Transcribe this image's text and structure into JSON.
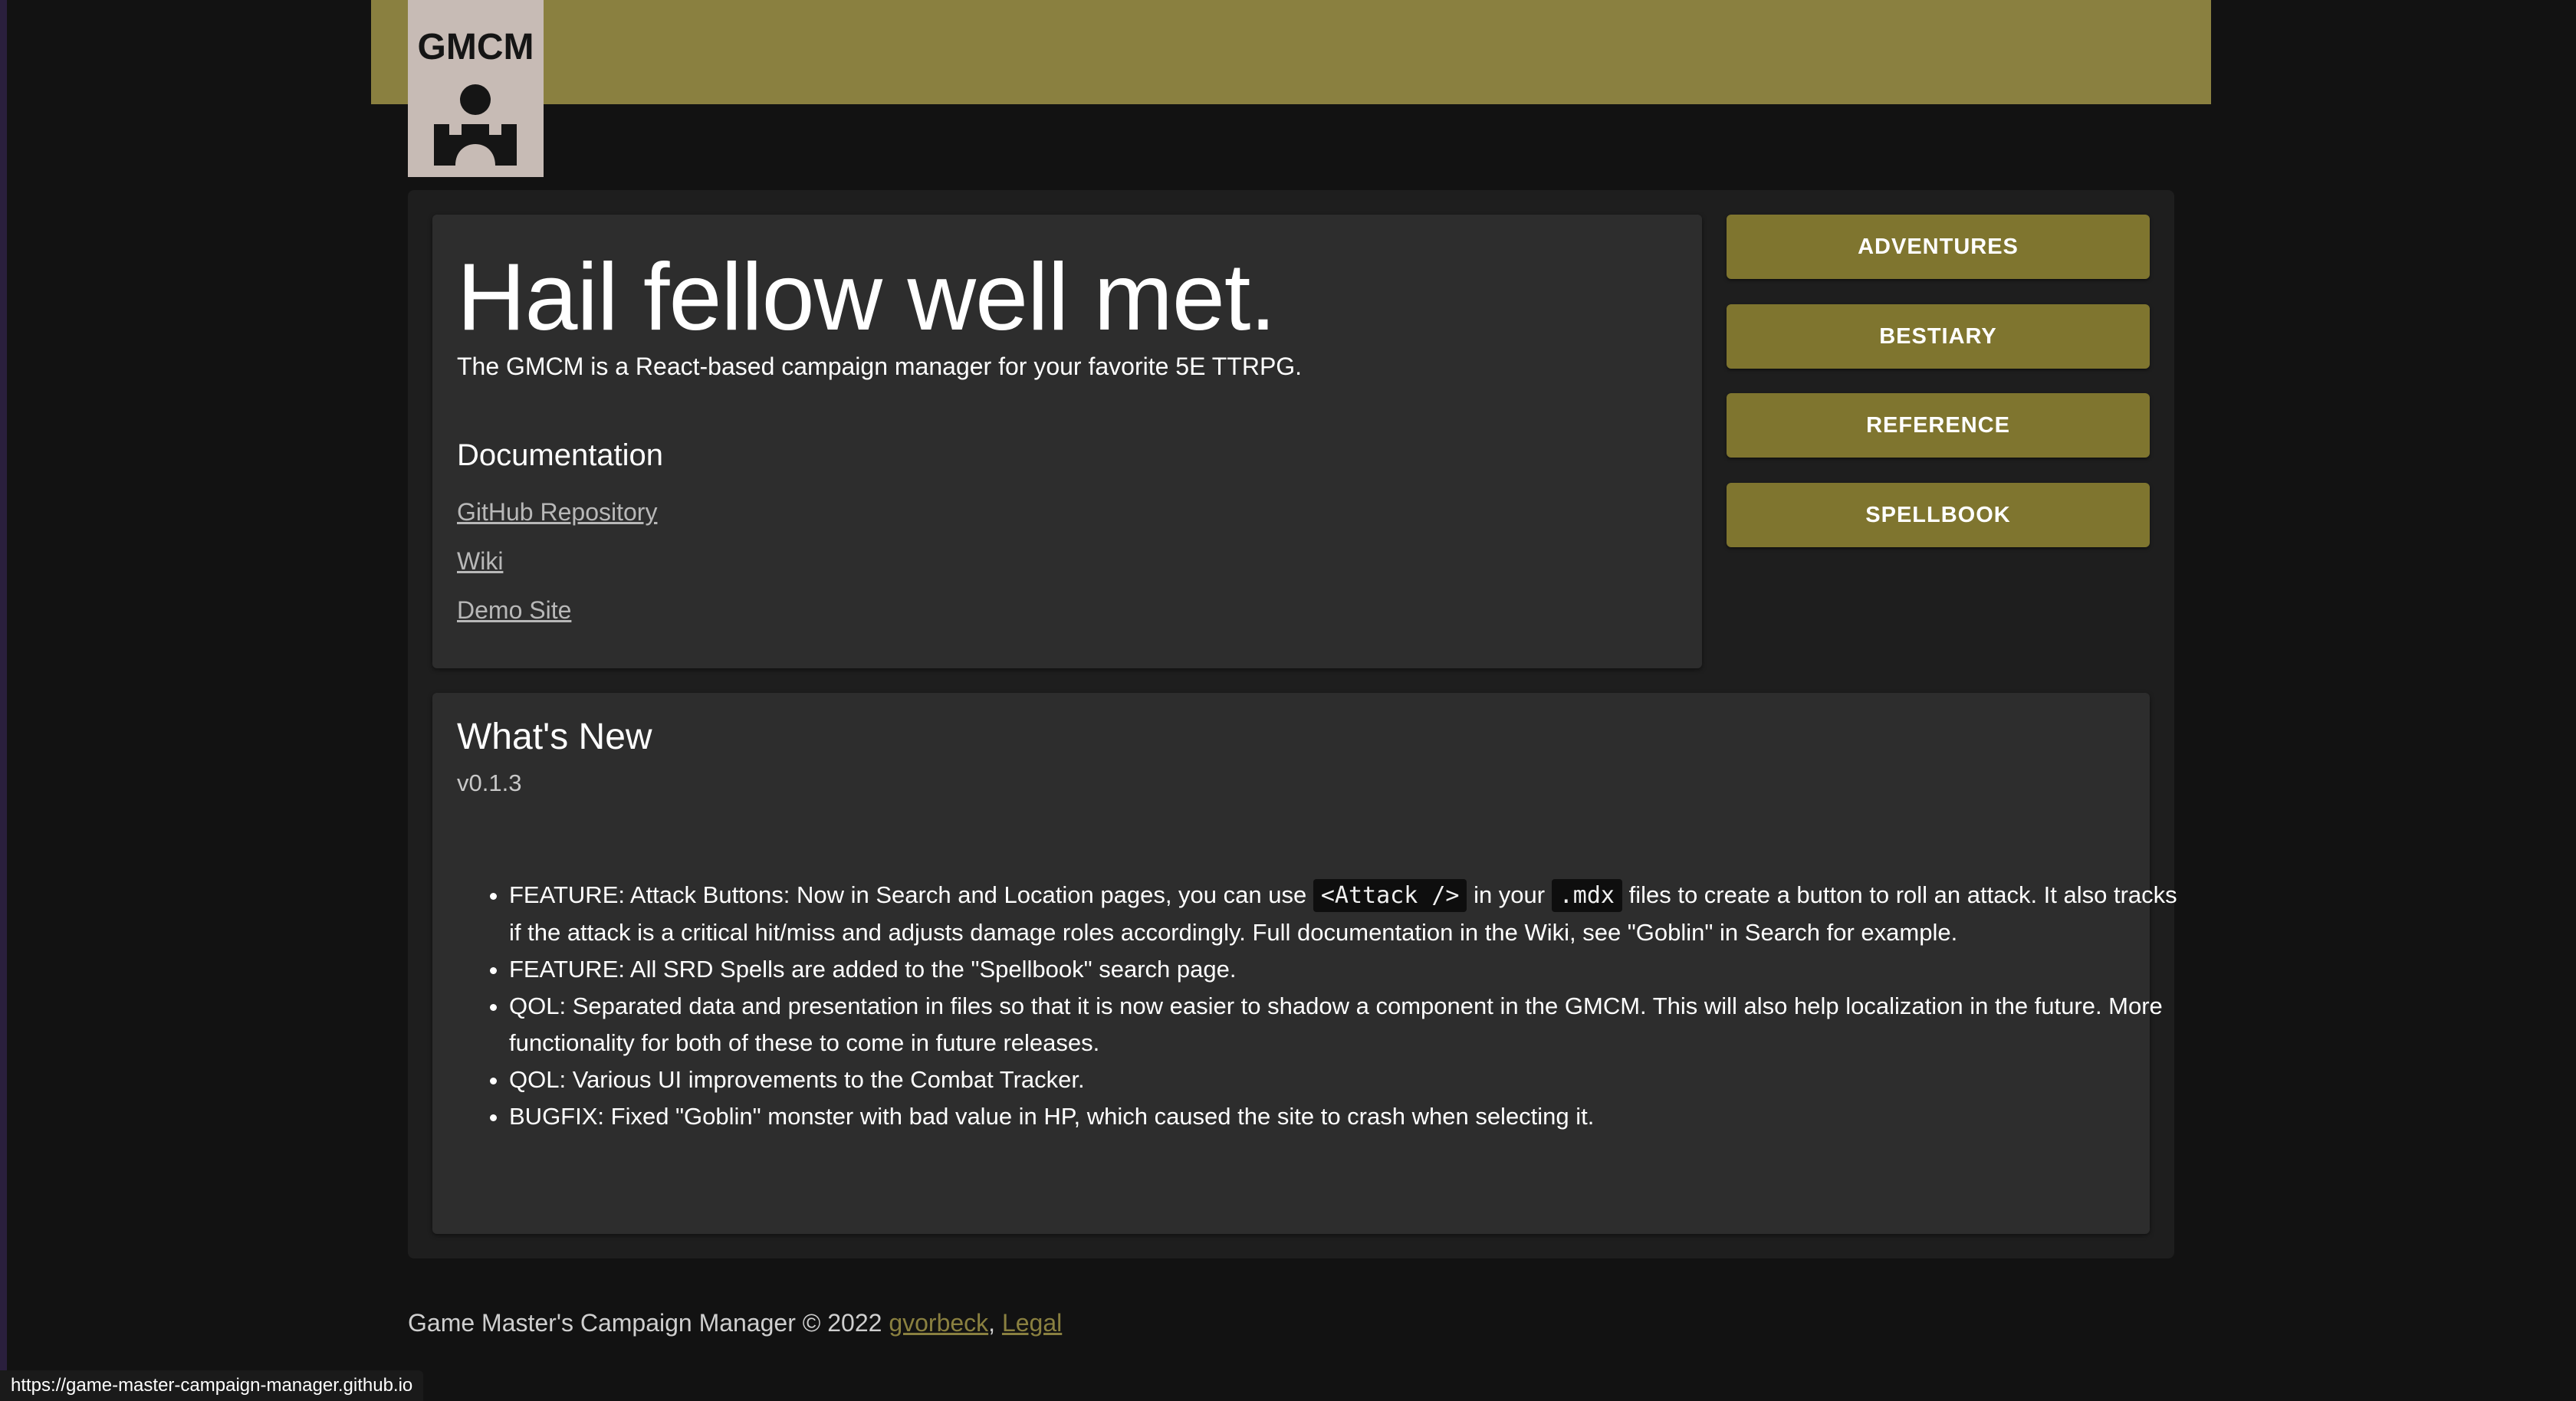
{
  "header": {
    "logo_text": "GMCM",
    "accent_color": "#8a8040",
    "logo_icon": "castle-person-icon"
  },
  "intro": {
    "title": "Hail fellow well met.",
    "description": "The GMCM is a React-based campaign manager for your favorite 5E TTRPG.",
    "documentation_heading": "Documentation",
    "links": [
      "GitHub Repository",
      "Wiki",
      "Demo Site"
    ]
  },
  "nav": {
    "buttons": [
      "ADVENTURES",
      "BESTIARY",
      "REFERENCE",
      "SPELLBOOK"
    ],
    "button_color": "#7f752f"
  },
  "whats_new": {
    "title": "What's New",
    "version": "v0.1.3",
    "items": [
      {
        "before": "FEATURE: Attack Buttons: Now in Search and Location pages, you can use ",
        "code1": "<Attack />",
        "middle": " in your ",
        "code2": ".mdx",
        "after": " files to create a button to roll an attack. It also tracks if the attack is a critical hit/miss and adjusts damage roles accordingly. Full documentation in the Wiki, see \"Goblin\" in Search for example."
      },
      "FEATURE: All SRD Spells are added to the \"Spellbook\" search page.",
      "QOL: Separated data and presentation in files so that it is now easier to shadow a component in the GMCM. This will also help localization in the future. More functionality for both of these to come in future releases.",
      "QOL: Various UI improvements to the Combat Tracker.",
      "BUGFIX: Fixed \"Goblin\" monster with bad value in HP, which caused the site to crash when selecting it."
    ]
  },
  "footer": {
    "text": "Game Master's Campaign Manager © 2022 ",
    "author_link": "gvorbeck",
    "separator": ", ",
    "legal_link": "Legal"
  },
  "status_bar": {
    "url": "https://game-master-campaign-manager.github.io"
  }
}
